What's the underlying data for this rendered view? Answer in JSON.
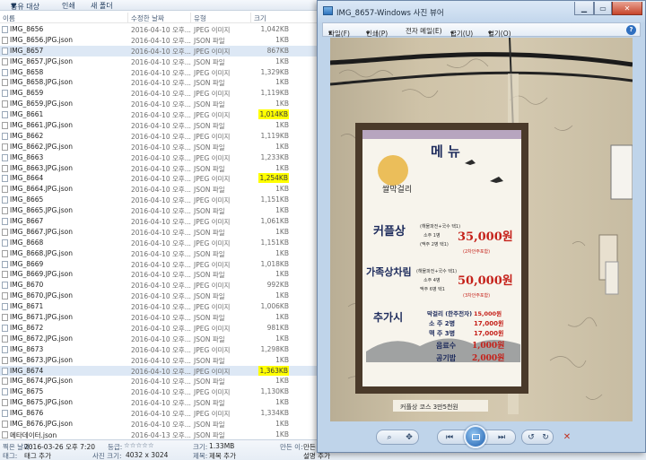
{
  "explorer": {
    "toolbar": {
      "share_label": "공유 대상",
      "print_label": "인쇄",
      "new_folder_label": "새 폴더"
    },
    "columns": {
      "name": "이름",
      "date": "수정한 날짜",
      "type": "유형",
      "size": "크기"
    },
    "files": [
      {
        "name": "IMG_8656",
        "date": "2016-04-10 오후...",
        "type": "JPEG 이미지",
        "size": "1,042KB",
        "kind": "jpeg",
        "highlight": false,
        "selected": false
      },
      {
        "name": "IMG_8656.JPG.json",
        "date": "2016-04-10 오후...",
        "type": "JSON 파일",
        "size": "1KB",
        "kind": "json",
        "highlight": false,
        "selected": false
      },
      {
        "name": "IMG_8657",
        "date": "2016-04-10 오후...",
        "type": "JPEG 이미지",
        "size": "867KB",
        "kind": "jpeg",
        "highlight": false,
        "selected": true
      },
      {
        "name": "IMG_8657.JPG.json",
        "date": "2016-04-10 오후...",
        "type": "JSON 파일",
        "size": "1KB",
        "kind": "json",
        "highlight": false,
        "selected": false
      },
      {
        "name": "IMG_8658",
        "date": "2016-04-10 오후...",
        "type": "JPEG 이미지",
        "size": "1,329KB",
        "kind": "jpeg",
        "highlight": false,
        "selected": false
      },
      {
        "name": "IMG_8658.JPG.json",
        "date": "2016-04-10 오후...",
        "type": "JSON 파일",
        "size": "1KB",
        "kind": "json",
        "highlight": false,
        "selected": false
      },
      {
        "name": "IMG_8659",
        "date": "2016-04-10 오후...",
        "type": "JPEG 이미지",
        "size": "1,119KB",
        "kind": "jpeg",
        "highlight": false,
        "selected": false
      },
      {
        "name": "IMG_8659.JPG.json",
        "date": "2016-04-10 오후...",
        "type": "JSON 파일",
        "size": "1KB",
        "kind": "json",
        "highlight": false,
        "selected": false
      },
      {
        "name": "IMG_8661",
        "date": "2016-04-10 오후...",
        "type": "JPEG 이미지",
        "size": "1,014KB",
        "kind": "jpeg",
        "highlight": true,
        "selected": false
      },
      {
        "name": "IMG_8661.JPG.json",
        "date": "2016-04-10 오후...",
        "type": "JSON 파일",
        "size": "1KB",
        "kind": "json",
        "highlight": false,
        "selected": false
      },
      {
        "name": "IMG_8662",
        "date": "2016-04-10 오후...",
        "type": "JPEG 이미지",
        "size": "1,119KB",
        "kind": "jpeg",
        "highlight": false,
        "selected": false
      },
      {
        "name": "IMG_8662.JPG.json",
        "date": "2016-04-10 오후...",
        "type": "JSON 파일",
        "size": "1KB",
        "kind": "json",
        "highlight": false,
        "selected": false
      },
      {
        "name": "IMG_8663",
        "date": "2016-04-10 오후...",
        "type": "JPEG 이미지",
        "size": "1,233KB",
        "kind": "jpeg",
        "highlight": false,
        "selected": false
      },
      {
        "name": "IMG_8663.JPG.json",
        "date": "2016-04-10 오후...",
        "type": "JSON 파일",
        "size": "1KB",
        "kind": "json",
        "highlight": false,
        "selected": false
      },
      {
        "name": "IMG_8664",
        "date": "2016-04-10 오후...",
        "type": "JPEG 이미지",
        "size": "1,254KB",
        "kind": "jpeg",
        "highlight": true,
        "selected": false
      },
      {
        "name": "IMG_8664.JPG.json",
        "date": "2016-04-10 오후...",
        "type": "JSON 파일",
        "size": "1KB",
        "kind": "json",
        "highlight": false,
        "selected": false
      },
      {
        "name": "IMG_8665",
        "date": "2016-04-10 오후...",
        "type": "JPEG 이미지",
        "size": "1,151KB",
        "kind": "jpeg",
        "highlight": false,
        "selected": false
      },
      {
        "name": "IMG_8665.JPG.json",
        "date": "2016-04-10 오후...",
        "type": "JSON 파일",
        "size": "1KB",
        "kind": "json",
        "highlight": false,
        "selected": false
      },
      {
        "name": "IMG_8667",
        "date": "2016-04-10 오후...",
        "type": "JPEG 이미지",
        "size": "1,061KB",
        "kind": "jpeg",
        "highlight": false,
        "selected": false
      },
      {
        "name": "IMG_8667.JPG.json",
        "date": "2016-04-10 오후...",
        "type": "JSON 파일",
        "size": "1KB",
        "kind": "json",
        "highlight": false,
        "selected": false
      },
      {
        "name": "IMG_8668",
        "date": "2016-04-10 오후...",
        "type": "JPEG 이미지",
        "size": "1,151KB",
        "kind": "jpeg",
        "highlight": false,
        "selected": false
      },
      {
        "name": "IMG_8668.JPG.json",
        "date": "2016-04-10 오후...",
        "type": "JSON 파일",
        "size": "1KB",
        "kind": "json",
        "highlight": false,
        "selected": false
      },
      {
        "name": "IMG_8669",
        "date": "2016-04-10 오후...",
        "type": "JPEG 이미지",
        "size": "1,018KB",
        "kind": "jpeg",
        "highlight": false,
        "selected": false
      },
      {
        "name": "IMG_8669.JPG.json",
        "date": "2016-04-10 오후...",
        "type": "JSON 파일",
        "size": "1KB",
        "kind": "json",
        "highlight": false,
        "selected": false
      },
      {
        "name": "IMG_8670",
        "date": "2016-04-10 오후...",
        "type": "JPEG 이미지",
        "size": "992KB",
        "kind": "jpeg",
        "highlight": false,
        "selected": false
      },
      {
        "name": "IMG_8670.JPG.json",
        "date": "2016-04-10 오후...",
        "type": "JSON 파일",
        "size": "1KB",
        "kind": "json",
        "highlight": false,
        "selected": false
      },
      {
        "name": "IMG_8671",
        "date": "2016-04-10 오후...",
        "type": "JPEG 이미지",
        "size": "1,006KB",
        "kind": "jpeg",
        "highlight": false,
        "selected": false
      },
      {
        "name": "IMG_8671.JPG.json",
        "date": "2016-04-10 오후...",
        "type": "JSON 파일",
        "size": "1KB",
        "kind": "json",
        "highlight": false,
        "selected": false
      },
      {
        "name": "IMG_8672",
        "date": "2016-04-10 오후...",
        "type": "JPEG 이미지",
        "size": "981KB",
        "kind": "jpeg",
        "highlight": false,
        "selected": false
      },
      {
        "name": "IMG_8672.JPG.json",
        "date": "2016-04-10 오후...",
        "type": "JSON 파일",
        "size": "1KB",
        "kind": "json",
        "highlight": false,
        "selected": false
      },
      {
        "name": "IMG_8673",
        "date": "2016-04-10 오후...",
        "type": "JPEG 이미지",
        "size": "1,298KB",
        "kind": "jpeg",
        "highlight": false,
        "selected": false
      },
      {
        "name": "IMG_8673.JPG.json",
        "date": "2016-04-10 오후...",
        "type": "JSON 파일",
        "size": "1KB",
        "kind": "json",
        "highlight": false,
        "selected": false
      },
      {
        "name": "IMG_8674",
        "date": "2016-04-10 오후...",
        "type": "JPEG 이미지",
        "size": "1,363KB",
        "kind": "jpeg",
        "highlight": true,
        "selected": true
      },
      {
        "name": "IMG_8674.JPG.json",
        "date": "2016-04-10 오후...",
        "type": "JSON 파일",
        "size": "1KB",
        "kind": "json",
        "highlight": false,
        "selected": false
      },
      {
        "name": "IMG_8675",
        "date": "2016-04-10 오후...",
        "type": "JPEG 이미지",
        "size": "1,130KB",
        "kind": "jpeg",
        "highlight": false,
        "selected": false
      },
      {
        "name": "IMG_8675.JPG.json",
        "date": "2016-04-10 오후...",
        "type": "JSON 파일",
        "size": "1KB",
        "kind": "json",
        "highlight": false,
        "selected": false
      },
      {
        "name": "IMG_8676",
        "date": "2016-04-10 오후...",
        "type": "JPEG 이미지",
        "size": "1,334KB",
        "kind": "jpeg",
        "highlight": false,
        "selected": false
      },
      {
        "name": "IMG_8676.JPG.json",
        "date": "2016-04-10 오후...",
        "type": "JSON 파일",
        "size": "1KB",
        "kind": "json",
        "highlight": false,
        "selected": false
      },
      {
        "name": "메타데이터.json",
        "date": "2016-04-13 오후...",
        "type": "JSON 파일",
        "size": "1KB",
        "kind": "json",
        "highlight": false,
        "selected": false
      }
    ],
    "details": {
      "date_label": "찍은 날짜:",
      "date_value": "2016-03-26 오후 7:20",
      "tags_label": "태그:",
      "tags_value": "태그 추가",
      "rating_label": "등급:",
      "rating_stars": "☆☆☆☆☆",
      "dimensions_label": "사진 크기:",
      "dimensions_value": "4032 x 3024",
      "size_label": "크기:",
      "size_value": "1.33MB",
      "title_label": "제목:",
      "title_value": "제목 추가",
      "created_label": "만든 이:",
      "created_value": "만든 이",
      "author_value": "설명 추가"
    }
  },
  "viewer": {
    "title": "IMG_8657-Windows 사진 뷰어",
    "window_buttons": {
      "minimize": "▁",
      "maximize": "▭",
      "close": "✕"
    },
    "menu": {
      "file": "파일(F)",
      "print": "인쇄(P)",
      "email": "전자 메일(E)",
      "burn": "굽기(U)",
      "open": "열기(O)",
      "caret": "▾",
      "help": "?"
    },
    "photo": {
      "menu_title": "메 뉴",
      "brand": "쌀막걸리",
      "sets": [
        {
          "name": "커플상",
          "items": [
            "(해물파전+국수 택1)",
            "소주 1병",
            "(맥주 2병 택1)"
          ],
          "price": "35,000원",
          "note": "(2차안주포함)"
        },
        {
          "name": "가족상차림",
          "items": [
            "(해물파전+국수 택1)",
            "소주 4병",
            "맥주 6병 택1"
          ],
          "price": "50,000원",
          "note": "(3차안주포함)"
        }
      ],
      "extra_label": "추가시",
      "extras": [
        {
          "name": "막걸리 (한주전자)",
          "price": "15,000원"
        },
        {
          "name": "소 주 2병",
          "price": "17,000원"
        },
        {
          "name": "맥 주 3병",
          "price": "17,000원"
        },
        {
          "name": "음료수",
          "price": "1,000원"
        },
        {
          "name": "공기밥",
          "price": "2,000원"
        }
      ],
      "footer": "커플상 코스 3만5천원"
    },
    "controls": {
      "zoom_icon": "⌕",
      "fit_icon": "✥",
      "prev_icon": "⏮",
      "next_icon": "⏭",
      "rotate_ccw_icon": "↺",
      "rotate_cw_icon": "↻",
      "delete_icon": "✕"
    }
  },
  "colors": {
    "highlight": "#ffff00",
    "selection": "#dde8f5",
    "frame_wood": "#4a3a2a",
    "menu_red": "#c5211a",
    "menu_navy": "#1d2b5c"
  }
}
